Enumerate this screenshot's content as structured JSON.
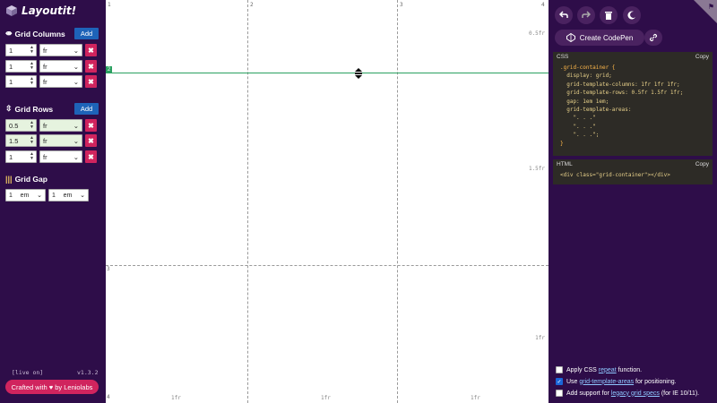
{
  "app": {
    "title": "Layoutit!"
  },
  "columns": {
    "title": "Grid Columns",
    "add_label": "Add",
    "items": [
      {
        "value": "1",
        "unit": "fr"
      },
      {
        "value": "1",
        "unit": "fr"
      },
      {
        "value": "1",
        "unit": "fr"
      }
    ]
  },
  "rows": {
    "title": "Grid Rows",
    "add_label": "Add",
    "items": [
      {
        "value": "0.5",
        "unit": "fr"
      },
      {
        "value": "1.5",
        "unit": "fr"
      },
      {
        "value": "1",
        "unit": "fr"
      }
    ]
  },
  "gap": {
    "title": "Grid Gap",
    "items": [
      {
        "value": "1",
        "unit": "em"
      },
      {
        "value": "1",
        "unit": "em"
      }
    ]
  },
  "footer": {
    "view_label": "[live on]",
    "version": "v1.3.2",
    "crafted": "Crafted with ♥ by Leniolabs"
  },
  "grid": {
    "col_numbers": [
      "1",
      "2",
      "3",
      "4"
    ],
    "row_numbers": [
      "1",
      "2",
      "3",
      "4"
    ],
    "col_labels": [
      "1fr",
      "1fr",
      "1fr"
    ],
    "row_labels": [
      "0.5fr",
      "1.5fr",
      "1fr"
    ],
    "guide_tag": "2"
  },
  "right": {
    "codepen_label": "Create CodePen",
    "css_title": "CSS",
    "html_title": "HTML",
    "copy_label": "Copy",
    "css_lines": [
      ".grid-container {",
      "  display: grid;",
      "  grid-template-columns: 1fr 1fr 1fr;",
      "  grid-template-rows: 0.5fr 1.5fr 1fr;",
      "  gap: 1em 1em;",
      "  grid-template-areas:",
      "    \". . .\"",
      "    \". . .\"",
      "    \". . .\";",
      "}"
    ],
    "html_line": "<div class=\"grid-container\"></div>",
    "options": [
      {
        "pre": "Apply CSS ",
        "link": "repeat",
        "post": " function.",
        "checked": false
      },
      {
        "pre": "Use ",
        "link": "grid-template-areas",
        "post": " for positioning.",
        "checked": true
      },
      {
        "pre": "Add support for ",
        "link": "legacy grid specs",
        "post": " (for IE 10/11).",
        "checked": false
      }
    ]
  },
  "colors": {
    "sidebar": "#2e0d49",
    "accent_blue": "#1e63b8",
    "accent_pink": "#d0245e",
    "guide_green": "#2aa060"
  }
}
